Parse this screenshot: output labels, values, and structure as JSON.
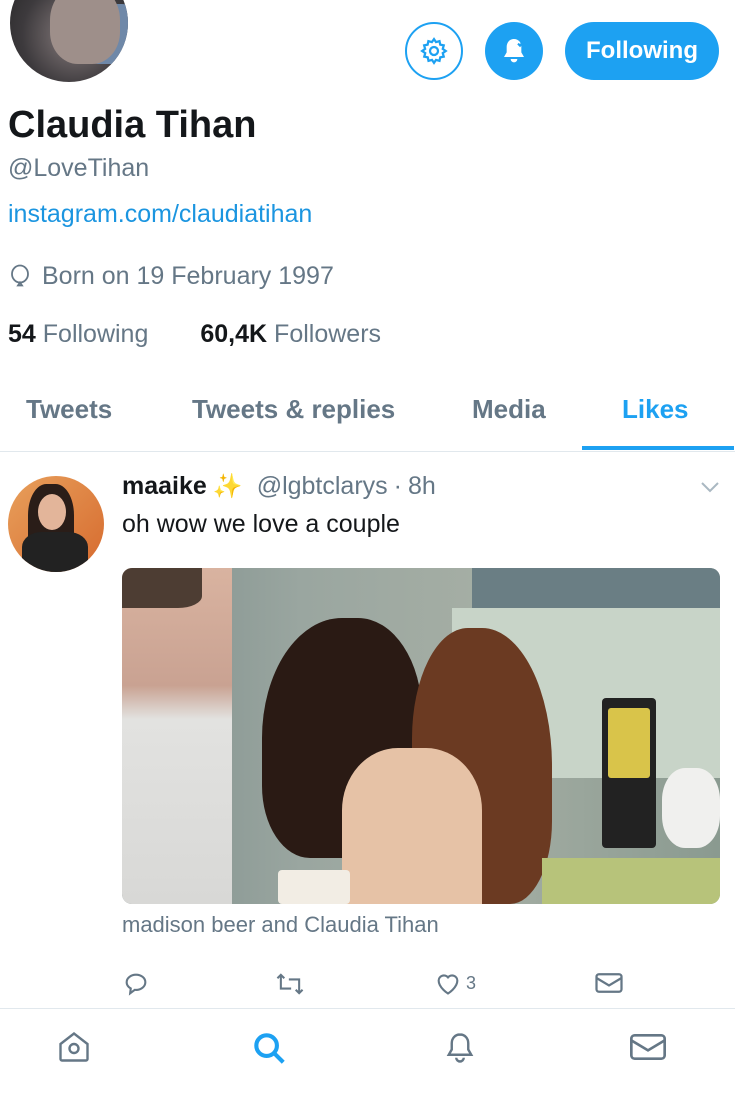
{
  "header": {
    "following_label": "Following"
  },
  "profile": {
    "name": "Claudia Tihan",
    "handle": "@LoveTihan",
    "website": "instagram.com/claudiatihan",
    "born": "Born on 19 February 1997",
    "following_count": "54",
    "following_label": "Following",
    "followers_count": "60,4K",
    "followers_label": "Followers"
  },
  "tabs": [
    {
      "label": "Tweets"
    },
    {
      "label": "Tweets & replies"
    },
    {
      "label": "Media"
    },
    {
      "label": "Likes",
      "active": true
    }
  ],
  "tweet": {
    "display_name": "maaike",
    "sparkle": "✨",
    "handle": "@lgbtclarys",
    "separator": "·",
    "time": "8h",
    "text": "oh wow we love a couple",
    "caption": "madison beer and Claudia Tihan",
    "like_count": "3"
  },
  "icons": {
    "accent": "#1da1f2",
    "muted": "#657786"
  }
}
